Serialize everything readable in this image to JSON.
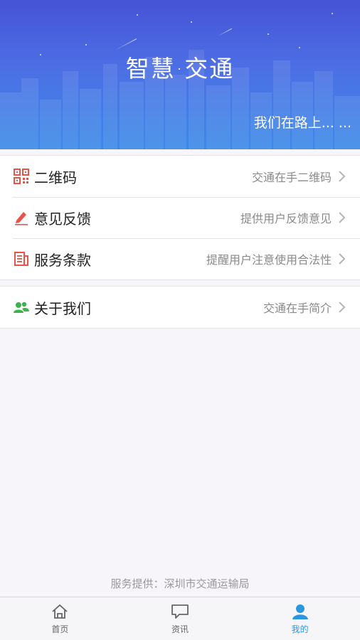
{
  "banner": {
    "logo_text": "智慧·交通",
    "slogan": "我们在路上... ..."
  },
  "menu_group_1": [
    {
      "title": "二维码",
      "desc": "交通在手二维码",
      "icon": "qr-code-icon",
      "icon_color": "#e8534a"
    },
    {
      "title": "意见反馈",
      "desc": "提供用户反馈意见",
      "icon": "pencil-icon",
      "icon_color": "#e8534a"
    },
    {
      "title": "服务条款",
      "desc": "提醒用户注意使用合法性",
      "icon": "document-icon",
      "icon_color": "#e8534a"
    }
  ],
  "menu_group_2": [
    {
      "title": "关于我们",
      "desc": "交通在手简介",
      "icon": "users-icon",
      "icon_color": "#3cb44b"
    }
  ],
  "footer_note": "服务提供：深圳市交通运输局",
  "tabbar": {
    "tabs": [
      {
        "label": "首页",
        "icon": "home-icon",
        "active": false
      },
      {
        "label": "资讯",
        "icon": "chat-bubble-icon",
        "active": false
      },
      {
        "label": "我的",
        "icon": "profile-icon",
        "active": true
      }
    ],
    "active_color": "#2c97de"
  }
}
